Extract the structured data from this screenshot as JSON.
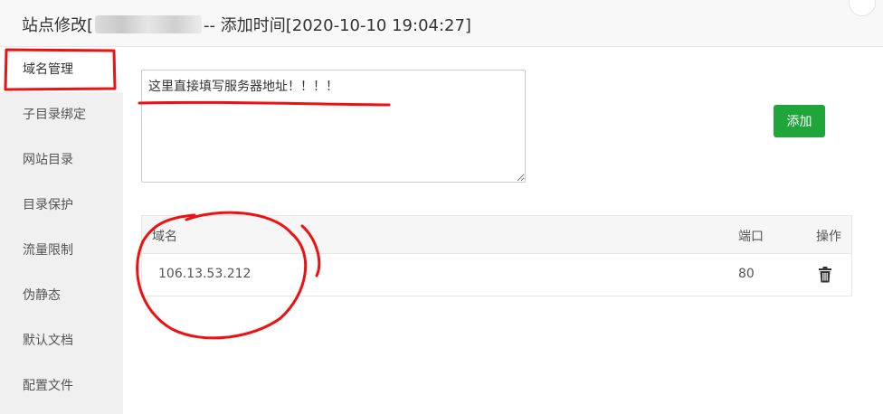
{
  "dialog": {
    "title_prefix": "站点修改[",
    "title_suffix": "-- 添加时间[2020-10-10 19:04:27]"
  },
  "sidebar": {
    "items": [
      {
        "label": "域名管理"
      },
      {
        "label": "子目录绑定"
      },
      {
        "label": "网站目录"
      },
      {
        "label": "目录保护"
      },
      {
        "label": "流量限制"
      },
      {
        "label": "伪静态"
      },
      {
        "label": "默认文档"
      },
      {
        "label": "配置文件"
      }
    ],
    "active_index": 0
  },
  "domain_form": {
    "value": "这里直接填写服务器地址！！！！",
    "add_label": "添加"
  },
  "domain_table": {
    "headers": {
      "domain": "域名",
      "port": "端口",
      "actions": "操作"
    },
    "rows": [
      {
        "domain": "106.13.53.212",
        "port": "80"
      }
    ]
  },
  "colors": {
    "primary_green": "#20a53a",
    "annotation_red": "#ee1111",
    "sidebar_bg": "#f0f0f0"
  },
  "icons": {
    "close": "close-icon",
    "delete": "trash-icon"
  }
}
